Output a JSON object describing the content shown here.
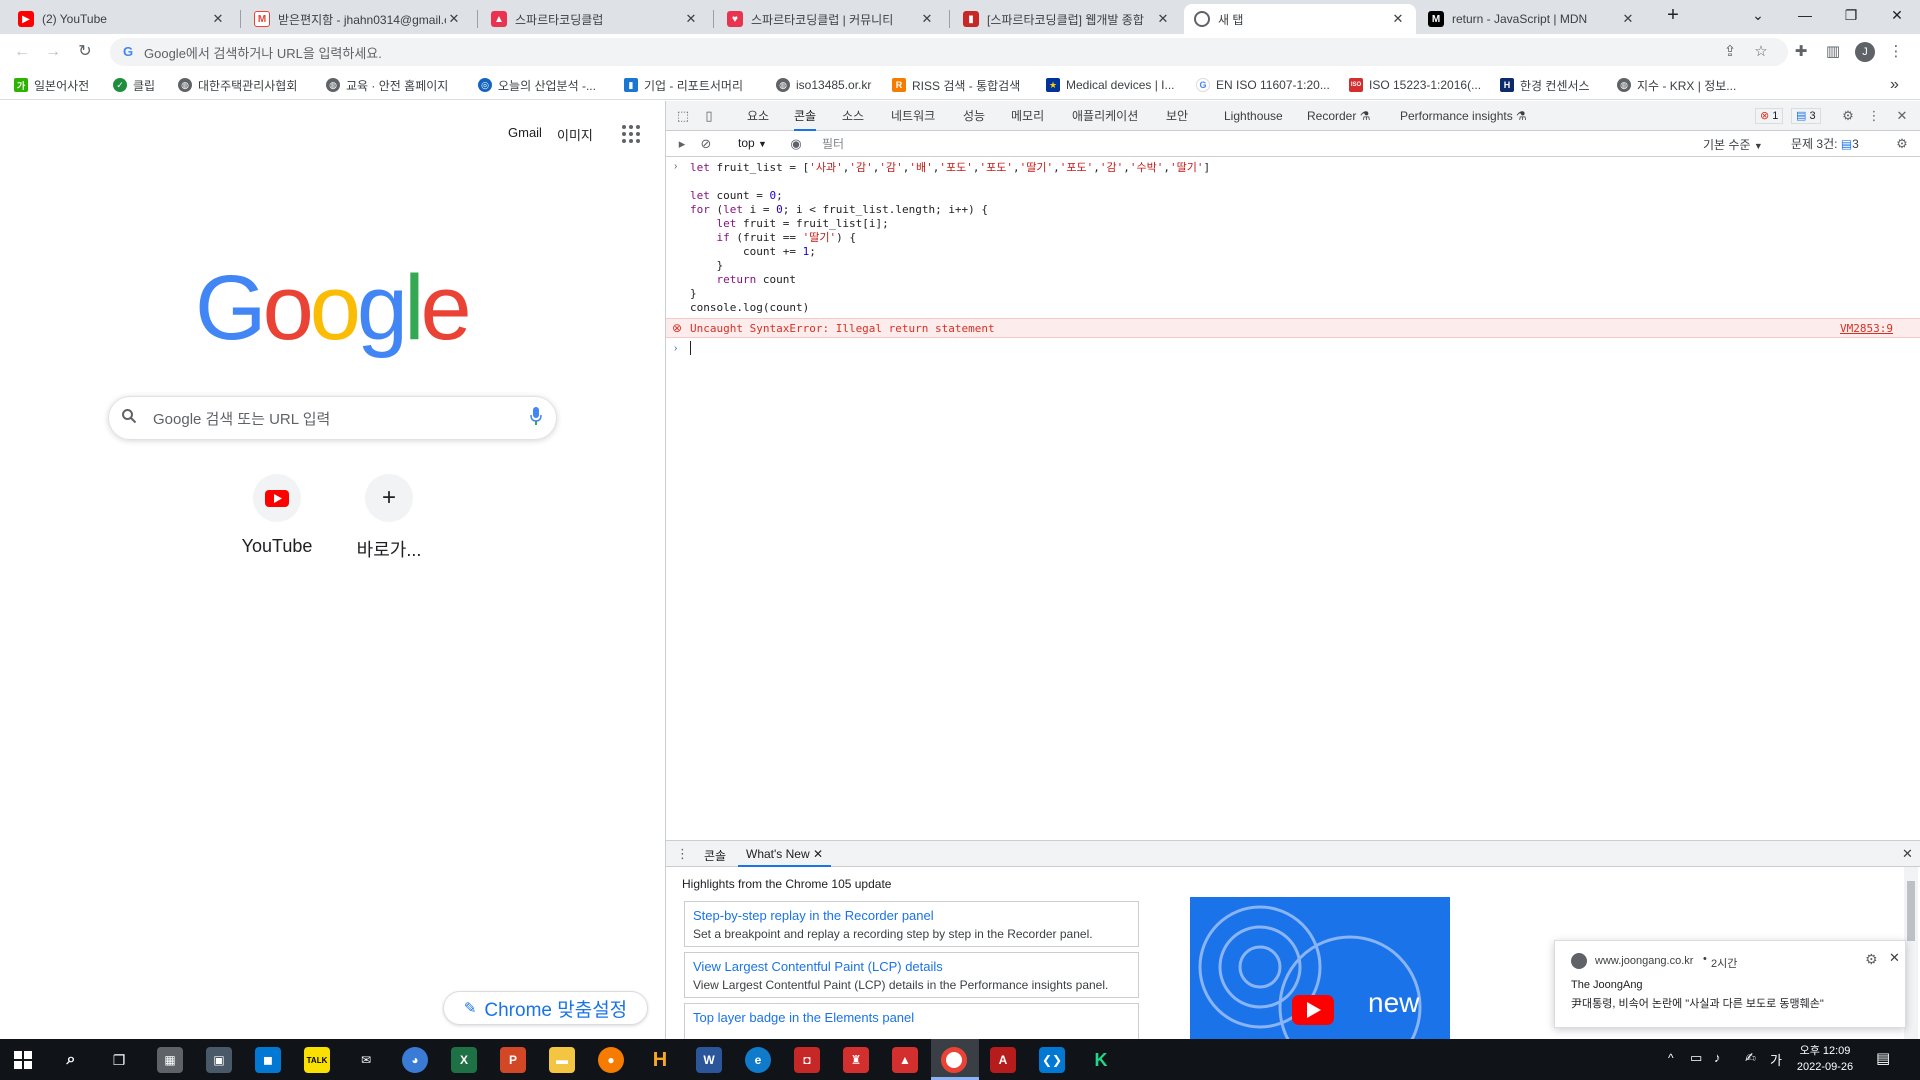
{
  "tabs": [
    {
      "title": "(2) YouTube",
      "icon": "youtube-icon",
      "color": "#ff0000"
    },
    {
      "title": "받은편지함 - jhahn0314@gmail.c",
      "icon": "gmail-icon",
      "color": "#ea4335"
    },
    {
      "title": "스파르타코딩클럽",
      "icon": "sparta-icon",
      "color": "#e8344e"
    },
    {
      "title": "스파르타코딩클럽 | 커뮤니티",
      "icon": "sparta-heart-icon",
      "color": "#e8344e"
    },
    {
      "title": "[스파르타코딩클럽] 웹개발 종합",
      "icon": "sparta-book-icon",
      "color": "#e8344e"
    },
    {
      "title": "새 탭",
      "icon": "chrome-icon",
      "color": "#5f6368"
    },
    {
      "title": "return - JavaScript | MDN",
      "icon": "mdn-icon",
      "color": "#000000"
    }
  ],
  "new_tab_symbol": "+",
  "window": {
    "minimize": "—",
    "maximize": "❐",
    "close": "✕",
    "dropdown": "⌄"
  },
  "omnibox": {
    "placeholder": "Google에서 검색하거나 URL을 입력하세요.",
    "profile_initial": "J"
  },
  "bookmarks": [
    {
      "label": "일본어사전",
      "color": "#2db400",
      "glyph": "가"
    },
    {
      "label": "클립",
      "color": "#1e8e3e",
      "glyph": "✓"
    },
    {
      "label": "대한주택관리사협회",
      "color": "#5f6368",
      "glyph": "◍"
    },
    {
      "label": "교육 · 안전 홈페이지",
      "color": "#5f6368",
      "glyph": "◍"
    },
    {
      "label": "오늘의 산업분석 -...",
      "color": "#1565c0",
      "glyph": "◎"
    },
    {
      "label": "기업 - 리포트서머리",
      "color": "#1976d2",
      "glyph": "▮"
    },
    {
      "label": "iso13485.or.kr",
      "color": "#5f6368",
      "glyph": "◍"
    },
    {
      "label": "RISS 검색 - 통합검색",
      "color": "#f57c00",
      "glyph": "R"
    },
    {
      "label": "Medical devices | I...",
      "color": "#003399",
      "glyph": "★"
    },
    {
      "label": "EN ISO 11607-1:20...",
      "color": "#4285f4",
      "glyph": "G"
    },
    {
      "label": "ISO 15223-1:2016(...",
      "color": "#d32f2f",
      "glyph": "ISO"
    },
    {
      "label": "한경 컨센서스",
      "color": "#0d2a6b",
      "glyph": "H"
    },
    {
      "label": "지수 - KRX | 정보...",
      "color": "#5f6368",
      "glyph": "◍"
    }
  ],
  "bookmarks_more": "»",
  "google": {
    "gmail": "Gmail",
    "images": "이미지",
    "search_placeholder": "Google 검색 또는 URL 입력",
    "shortcuts": [
      {
        "label": "YouTube",
        "icon": "youtube-icon"
      },
      {
        "label": "바로가...",
        "icon": "plus-icon",
        "glyph": "+"
      }
    ],
    "customize": "Chrome 맞춤설정",
    "logo_letters": [
      "G",
      "o",
      "o",
      "g",
      "l",
      "e"
    ],
    "logo_colors": [
      "#4285f4",
      "#ea4335",
      "#fbbc05",
      "#4285f4",
      "#34a853",
      "#ea4335"
    ]
  },
  "devtools": {
    "tabs": [
      "요소",
      "콘솔",
      "소스",
      "네트워크",
      "성능",
      "메모리",
      "애플리케이션",
      "보안",
      "Lighthouse",
      "Recorder ⚗",
      "Performance insights ⚗"
    ],
    "active_tab": "콘솔",
    "error_count": "1",
    "message_count": "3",
    "context": "top",
    "filter_placeholder": "필터",
    "levels": "기본 수준",
    "issues": "문제 3건:",
    "issues_count": "3",
    "code_lines": [
      "let fruit_list = ['사과','감','감','배','포도','포도','딸기','포도','감','수박','딸기']",
      "",
      "let count = 0;",
      "for (let i = 0; i < fruit_list.length; i++) {",
      "    let fruit = fruit_list[i];",
      "    if (fruit == '딸기') {",
      "        count += 1;",
      "    }",
      "    return count",
      "}",
      "console.log(count)"
    ],
    "error_message": "Uncaught SyntaxError: Illegal return statement",
    "error_source": "VM2853:9",
    "drawer": {
      "tabs": [
        "콘솔",
        "What's New"
      ],
      "active_tab": "What's New",
      "headline": "Highlights from the Chrome 105 update",
      "cards": [
        {
          "title": "Step-by-step replay in the Recorder panel",
          "desc": "Set a breakpoint and replay a recording step by step in the Recorder panel."
        },
        {
          "title": "View Largest Contentful Paint (LCP) details",
          "desc": "View Largest Contentful Paint (LCP) details in the Performance insights panel."
        },
        {
          "title": "Top layer badge in the Elements panel",
          "desc": ""
        }
      ],
      "video_text": "new"
    }
  },
  "notification": {
    "source": "www.joongang.co.kr",
    "time": "2시간",
    "publisher": "The JoongAng",
    "message": "尹대통령, 비속어 논란에 \"사실과 다른 보도로 동맹훼손\""
  },
  "taskbar": {
    "time": "오후 12:09",
    "date": "2022-09-26",
    "ime": "가",
    "tray_up": "^"
  }
}
